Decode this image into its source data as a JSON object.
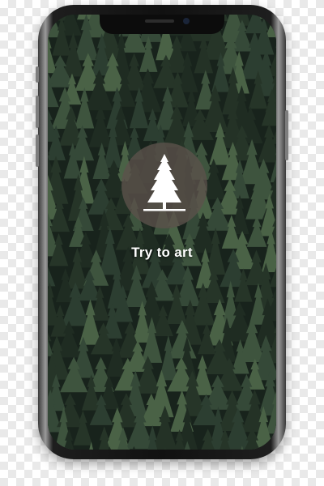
{
  "app": {
    "title": "Try to art",
    "logo_icon": "pine-tree-icon"
  },
  "colors": {
    "logo_circle": "#5c524c",
    "text": "#ffffff",
    "forest_dark": "#1f2b22",
    "forest_light": "#5f7e5b"
  }
}
